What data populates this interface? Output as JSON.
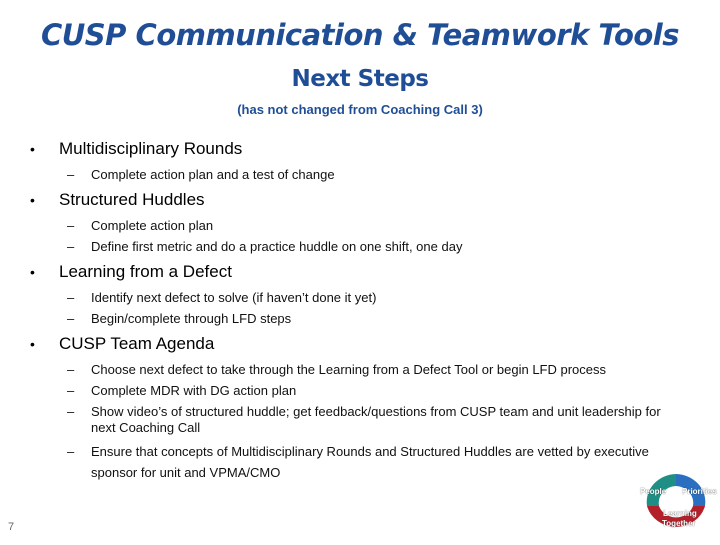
{
  "slide": {
    "title": "CUSP Communication & Teamwork Tools",
    "subtitle": "Next Steps",
    "note": "(has not changed from Coaching Call 3)",
    "page_number": "7"
  },
  "bullets": [
    {
      "label": "Multidisciplinary Rounds",
      "items": [
        "Complete action plan and a test of change"
      ]
    },
    {
      "label": "Structured Huddles",
      "items": [
        "Complete action plan",
        "Define first metric and do a practice huddle on one shift, one day"
      ]
    },
    {
      "label": "Learning from a Defect",
      "items": [
        "Identify next defect to solve (if haven’t done it yet)",
        "Begin/complete through LFD steps"
      ]
    },
    {
      "label": "CUSP Team Agenda",
      "items": [
        "Choose next defect to take through the Learning from a Defect Tool or begin LFD process",
        "Complete MDR with DG action plan",
        "Show video’s of structured huddle; get feedback/questions from CUSP team and unit leadership for next Coaching Call",
        "Ensure that concepts of Multidisciplinary Rounds and Structured Huddles are vetted by executive sponsor for unit and VPMA/CMO"
      ]
    }
  ],
  "symbols": {
    "bullet": "•",
    "dash": "–"
  },
  "logo": {
    "labels": {
      "people": "People",
      "priorities": "Priorities",
      "learning": "Learning",
      "together": "Together"
    },
    "colors": {
      "teal": "#1f8f86",
      "blue": "#2a6fc0",
      "red": "#b3202a"
    }
  }
}
